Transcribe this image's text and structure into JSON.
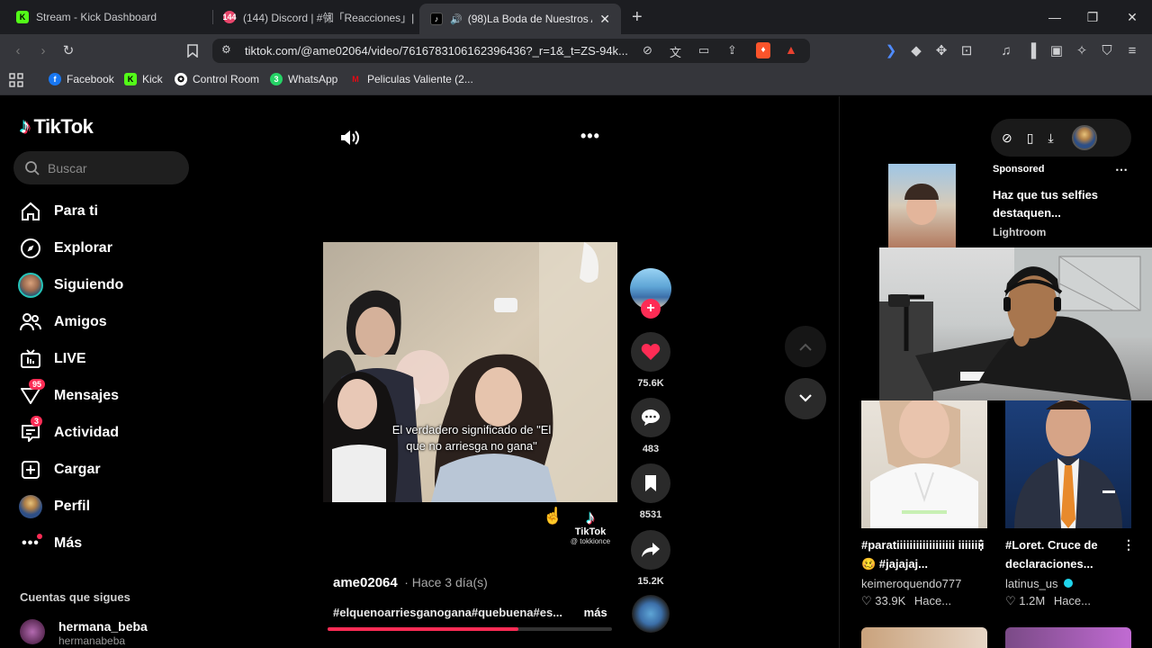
{
  "browser": {
    "tabs": [
      {
        "title": "Stream - Kick Dashboard",
        "icon": "kick-icon"
      },
      {
        "title": "(144) Discord | #㋿「Reacciones」| B",
        "icon": "discord-icon",
        "badge": "144"
      },
      {
        "title": "(98)La Boda de Nuestros Ami",
        "icon": "tiktok-icon",
        "active": true
      }
    ],
    "new_tab": "+",
    "url": "tiktok.com/@ame02064/video/7616783106162396436?_r=1&_t=ZS-94k...",
    "bookmarks": [
      {
        "label": "Facebook",
        "icon": "facebook-icon"
      },
      {
        "label": "Kick",
        "icon": "kick-icon"
      },
      {
        "label": "Control Room",
        "icon": "control-room-icon"
      },
      {
        "label": "WhatsApp",
        "icon": "whatsapp-icon",
        "badge": "3"
      },
      {
        "label": "Peliculas Valiente (2...",
        "icon": "peliculas-icon"
      }
    ]
  },
  "sidebar": {
    "logo": "TikTok",
    "search_placeholder": "Buscar",
    "items": [
      {
        "label": "Para ti",
        "icon": "home-icon"
      },
      {
        "label": "Explorar",
        "icon": "compass-icon"
      },
      {
        "label": "Siguiendo",
        "icon": "following-avatar-icon"
      },
      {
        "label": "Amigos",
        "icon": "friends-icon"
      },
      {
        "label": "LIVE",
        "icon": "live-icon"
      },
      {
        "label": "Mensajes",
        "icon": "messages-icon",
        "badge": "95"
      },
      {
        "label": "Actividad",
        "icon": "activity-icon",
        "badge": "3"
      },
      {
        "label": "Cargar",
        "icon": "upload-icon"
      },
      {
        "label": "Perfil",
        "icon": "profile-avatar-icon"
      },
      {
        "label": "Más",
        "icon": "more-icon"
      }
    ],
    "following_header": "Cuentas que sigues",
    "following": [
      {
        "name": "hermana_beba",
        "handle": "hermanabeba"
      }
    ]
  },
  "video": {
    "caption_overlay": "El verdadero significado de \"El que no arriesga no gana\"",
    "watermark_brand": "TikTok",
    "watermark_handle": "@ tokkionce",
    "author": "ame02064",
    "time_ago": "· Hace 3 día(s)",
    "hashtags": "#elquenoarriesganogana#quebuena#es...",
    "more": "más",
    "progress": 0.67
  },
  "actions": {
    "likes": "75.6K",
    "comments": "483",
    "saves": "8531",
    "shares": "15.2K"
  },
  "right": {
    "sponsored": {
      "label": "Sponsored",
      "title": "Haz que tus selfies destaquen...",
      "brand": "Lightroom"
    },
    "cards": [
      {
        "title": "#paratiiiiiiiiiiiiiiiiii iiiiiiii 🥴 #jajajaj...",
        "author": "keimeroquendo777",
        "likes": "33.9K",
        "time": "Hace..."
      },
      {
        "title": "#Loret. Cruce de declaraciones...",
        "author": "latinus_us",
        "likes": "1.2M",
        "time": "Hace..."
      }
    ]
  },
  "colors": {
    "accent": "#fe2c55",
    "background": "#000000",
    "browser_chrome": "#35363b"
  }
}
